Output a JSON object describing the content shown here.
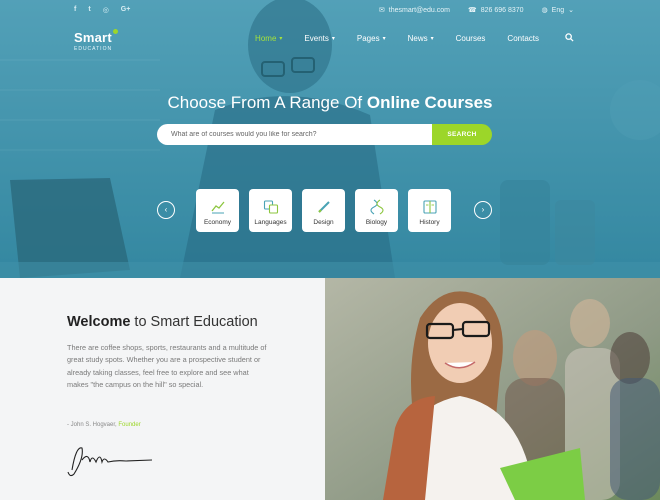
{
  "topbar": {
    "social": [
      "f",
      "t",
      "◎",
      "G+"
    ],
    "email": "thesmart@edu.com",
    "phone": "826 696 8370",
    "language": "Eng"
  },
  "logo": {
    "name": "Smart",
    "sub": "EDUCATION"
  },
  "nav": {
    "items": [
      {
        "label": "Home",
        "dropdown": true,
        "active": true
      },
      {
        "label": "Events",
        "dropdown": true
      },
      {
        "label": "Pages",
        "dropdown": true
      },
      {
        "label": "News",
        "dropdown": true
      },
      {
        "label": "Courses",
        "dropdown": false
      },
      {
        "label": "Contacts",
        "dropdown": false
      }
    ]
  },
  "hero": {
    "headline_prefix": "Choose From A Range Of ",
    "headline_bold": "Online Courses",
    "search_placeholder": "What are of courses would you like for search?",
    "search_button": "SEARCH",
    "categories": [
      {
        "label": "Economy",
        "icon": "chart-icon"
      },
      {
        "label": "Languages",
        "icon": "translate-icon"
      },
      {
        "label": "Design",
        "icon": "pencil-icon"
      },
      {
        "label": "Biology",
        "icon": "dna-icon"
      },
      {
        "label": "History",
        "icon": "book-icon"
      }
    ]
  },
  "welcome": {
    "title_bold": "Welcome",
    "title_rest": " to Smart Education",
    "body": "There are coffee shops, sports, restaurants and a multitude of great study spots. Whether you are a prospective student or already taking classes, feel free to explore and see what makes \"the campus on the hill\" so special.",
    "cite_name": "- John S. Hogvaer, ",
    "cite_role": "Founder"
  },
  "colors": {
    "accent": "#9cd629",
    "hero_overlay": "#2f7894",
    "welcome_bg": "#f4f5f6"
  }
}
